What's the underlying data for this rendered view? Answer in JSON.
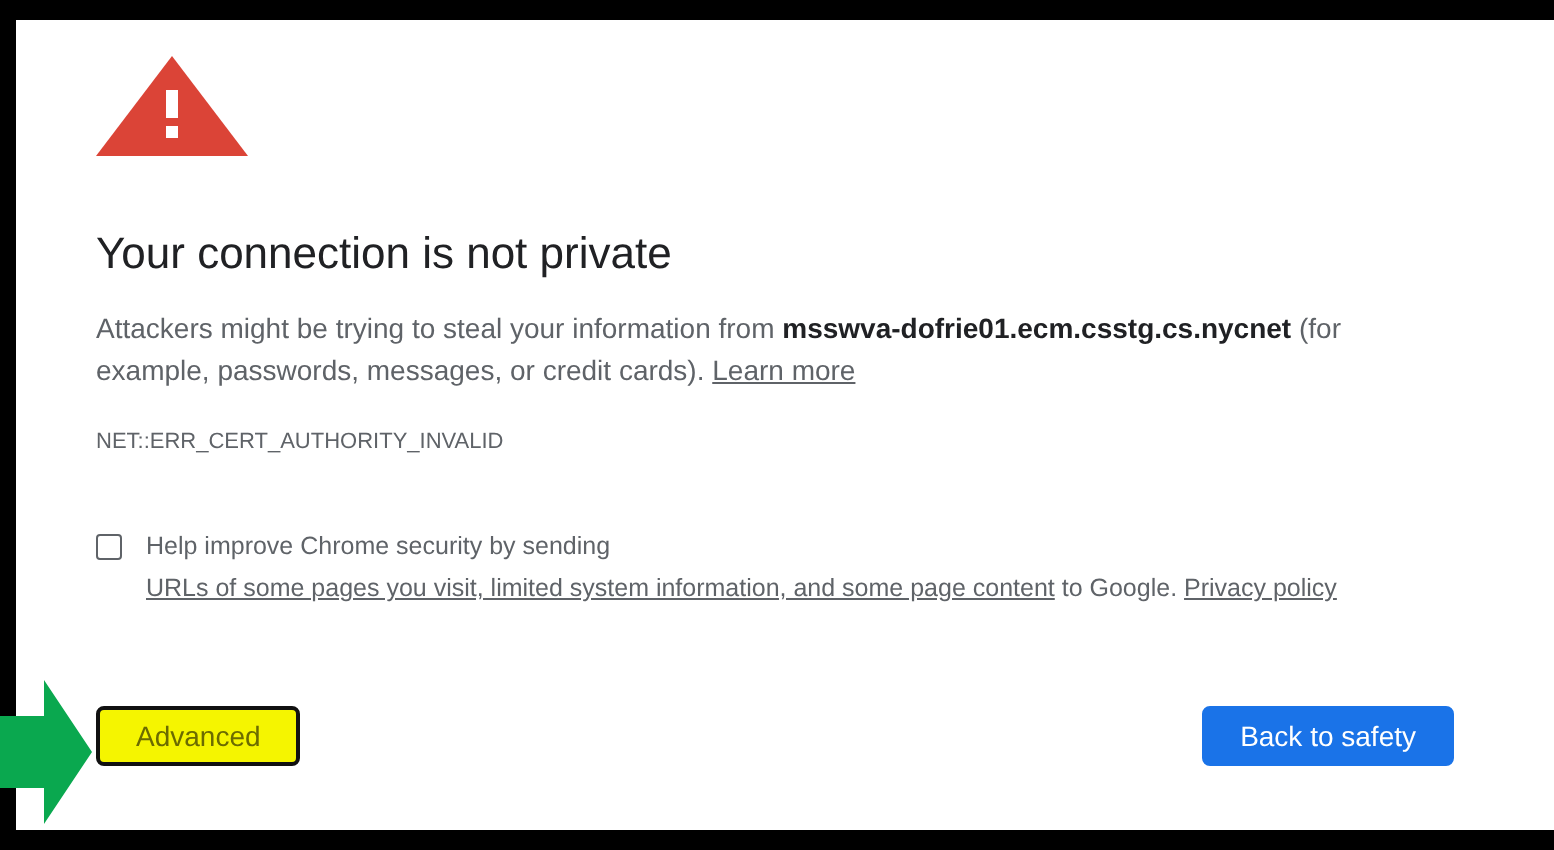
{
  "heading": "Your connection is not private",
  "message": {
    "text": "Attackers might be trying to steal your information from **msswva-dofrie01.ecm.csstg.cs.nycnet** (for example, passwords, messages, or credit cards).",
    "link": "Learn more"
  },
  "error_code": "NET::ERR_CERT_AUTHORITY_INVALID",
  "report_option": {
    "checked": false,
    "parts": [
      {
        "kind": "text",
        "text": "Help improve Chrome security by sending "
      },
      {
        "kind": "link",
        "text": "URLs of some pages you visit, limited system information, and some page content"
      },
      {
        "kind": "text",
        "text": " to Google. "
      },
      {
        "kind": "link",
        "text": "Privacy policy"
      }
    ]
  },
  "buttons": [
    {
      "label": "Advanced",
      "kind": "secondary",
      "highlighted": true
    },
    {
      "label": "Back to safety",
      "kind": "primary",
      "highlighted": false
    }
  ]
}
